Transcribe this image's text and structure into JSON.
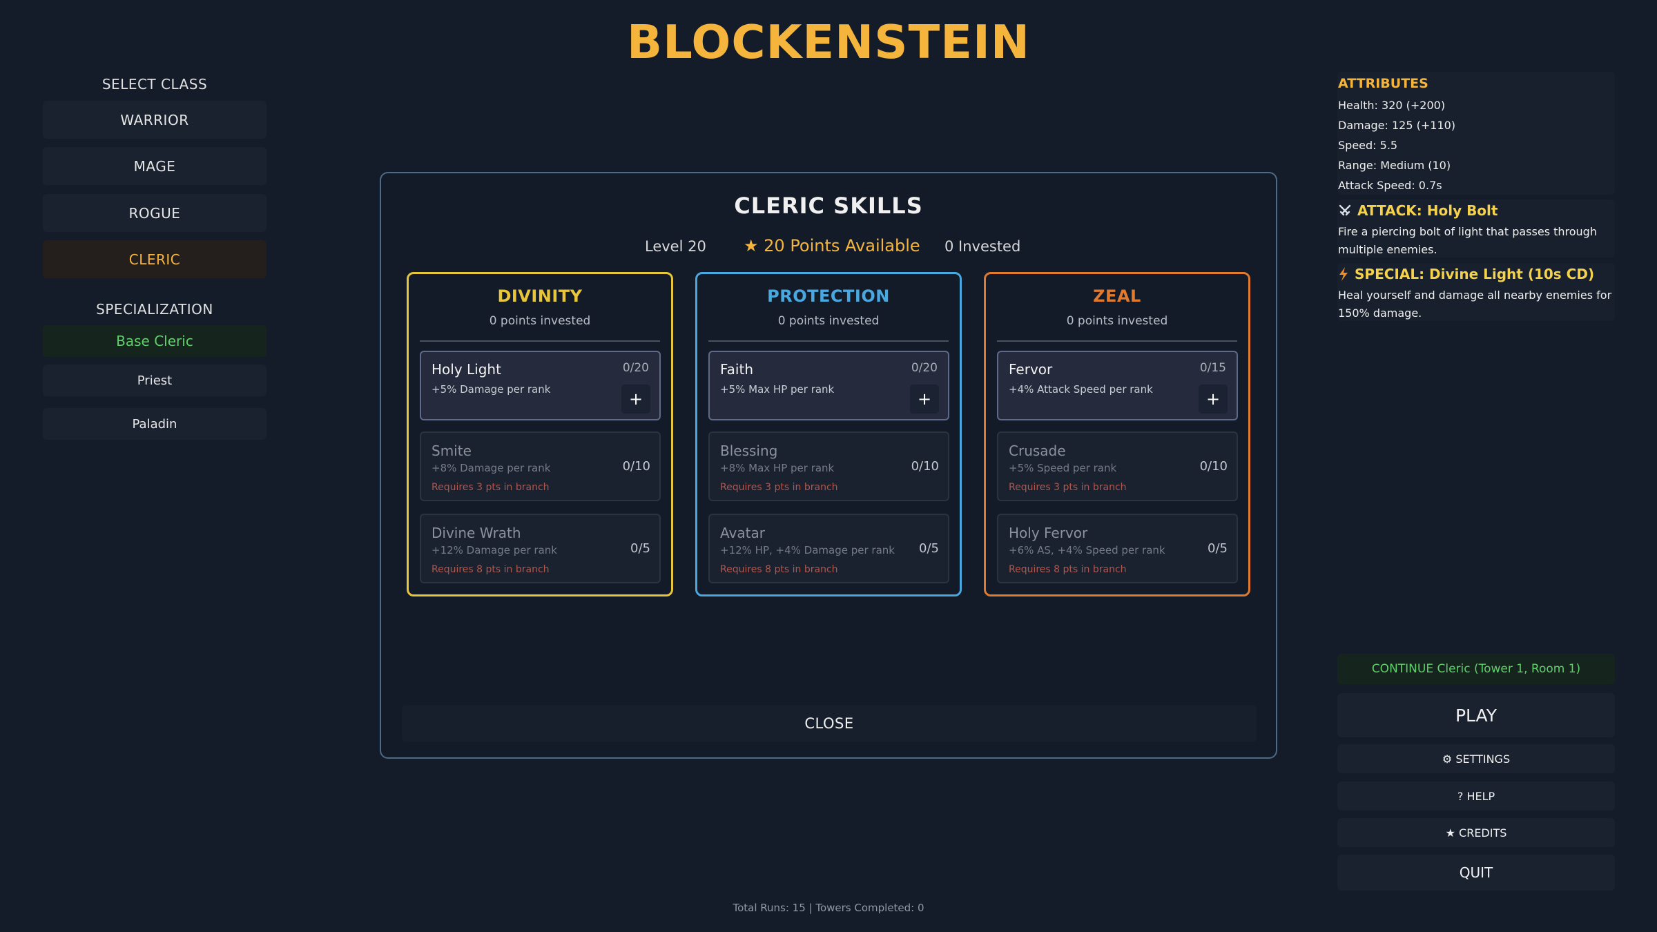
{
  "game_title": "BLOCKENSTEIN",
  "left_panel": {
    "select_class_heading": "SELECT CLASS",
    "classes": [
      {
        "label": "WARRIOR",
        "active": false
      },
      {
        "label": "MAGE",
        "active": false
      },
      {
        "label": "ROGUE",
        "active": false
      },
      {
        "label": "CLERIC",
        "active": true
      }
    ],
    "specialization_heading": "SPECIALIZATION",
    "specializations": [
      {
        "label": "Base Cleric",
        "active": true
      },
      {
        "label": "Priest",
        "active": false
      },
      {
        "label": "Paladin",
        "active": false
      }
    ]
  },
  "right_panel": {
    "attributes_title": "ATTRIBUTES",
    "attributes": [
      "Health: 320 (+200)",
      "Damage: 125 (+110)",
      "Speed: 5.5",
      "Range: Medium (10)",
      "Attack Speed: 0.7s"
    ],
    "attack": {
      "icon": "swords-icon",
      "title": "ATTACK: Holy Bolt",
      "description": "Fire a piercing bolt of light that passes through multiple enemies."
    },
    "special": {
      "icon": "lightning-icon",
      "title": "SPECIAL: Divine Light (10s CD)",
      "description": "Heal yourself and damage all nearby enemies for 150% damage."
    },
    "continue_label": "CONTINUE Cleric (Tower 1, Room 1)",
    "play_label": "PLAY",
    "settings_label": "⚙ SETTINGS",
    "help_label": "? HELP",
    "credits_label": "★ CREDITS",
    "quit_label": "QUIT"
  },
  "footer": "Total Runs: 15 | Towers Completed: 0",
  "modal": {
    "title": "CLERIC SKILLS",
    "level": "Level 20",
    "points_available": "★ 20 Points Available",
    "invested": "0 Invested",
    "close_label": "CLOSE",
    "branches": [
      {
        "name": "DIVINITY",
        "color": "#e8c63a",
        "points": "0 points invested",
        "skills": [
          {
            "name": "Holy Light",
            "desc": "+5% Damage per rank",
            "rank": "0/20",
            "unlocked": true,
            "req": ""
          },
          {
            "name": "Smite",
            "desc": "+8% Damage per rank",
            "rank": "0/10",
            "unlocked": false,
            "req": "Requires 3 pts in branch"
          },
          {
            "name": "Divine Wrath",
            "desc": "+12% Damage per rank",
            "rank": "0/5",
            "unlocked": false,
            "req": "Requires 8 pts in branch"
          }
        ]
      },
      {
        "name": "PROTECTION",
        "color": "#4aa8e0",
        "points": "0 points invested",
        "skills": [
          {
            "name": "Faith",
            "desc": "+5% Max HP per rank",
            "rank": "0/20",
            "unlocked": true,
            "req": ""
          },
          {
            "name": "Blessing",
            "desc": "+8% Max HP per rank",
            "rank": "0/10",
            "unlocked": false,
            "req": "Requires 3 pts in branch"
          },
          {
            "name": "Avatar",
            "desc": "+12% HP, +4% Damage per rank",
            "rank": "0/5",
            "unlocked": false,
            "req": "Requires 8 pts in branch"
          }
        ]
      },
      {
        "name": "ZEAL",
        "color": "#e07a2e",
        "points": "0 points invested",
        "skills": [
          {
            "name": "Fervor",
            "desc": "+4% Attack Speed per rank",
            "rank": "0/15",
            "unlocked": true,
            "req": ""
          },
          {
            "name": "Crusade",
            "desc": "+5% Speed per rank",
            "rank": "0/10",
            "unlocked": false,
            "req": "Requires 3 pts in branch"
          },
          {
            "name": "Holy Fervor",
            "desc": "+6% AS, +4% Speed per rank",
            "rank": "0/5",
            "unlocked": false,
            "req": "Requires 8 pts in branch"
          }
        ]
      }
    ]
  }
}
